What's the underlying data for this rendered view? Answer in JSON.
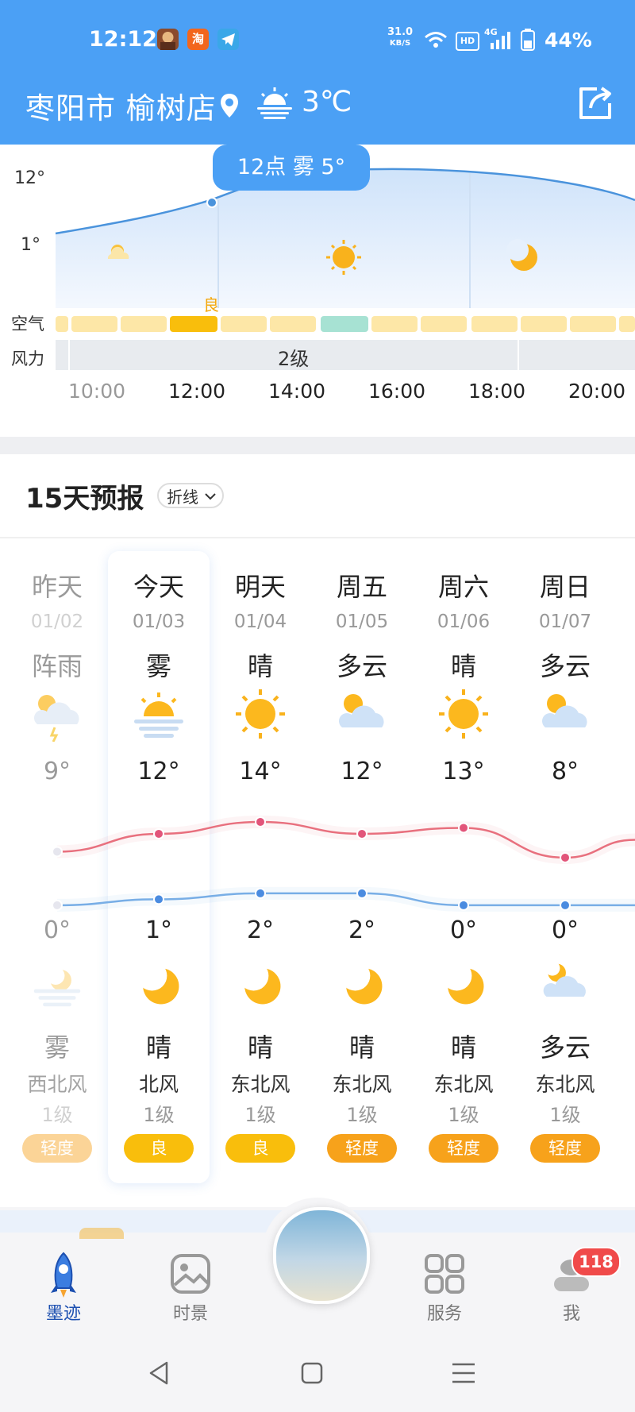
{
  "status_bar": {
    "time": "12:12",
    "app_icons": [
      "game-icon",
      "taobao-icon",
      "telegram-icon"
    ],
    "taobao_label": "淘",
    "net_speed_value": "31.0",
    "net_speed_unit": "KB/S",
    "hd_label": "HD",
    "network_label": "4G",
    "battery": "44%"
  },
  "header": {
    "location": "枣阳市 榆树店",
    "current_temp": "3℃",
    "weather_icon": "fog-sun-icon"
  },
  "hourly": {
    "tooltip": "12点 雾 5°",
    "y_labels": [
      "12°",
      "1°"
    ],
    "air_label": "空气",
    "air_quality_marker": "良",
    "wind_label": "风力",
    "wind_value": "2级",
    "times": [
      "10:00",
      "12:00",
      "14:00",
      "16:00",
      "18:00",
      "20:00"
    ],
    "icons": [
      "sun-cloud-icon",
      "sun-icon",
      "moon-icon"
    ],
    "chart_data": {
      "type": "area",
      "x": [
        "10:00",
        "11:00",
        "12:00",
        "13:00",
        "14:00",
        "16:00",
        "18:00",
        "20:00"
      ],
      "series": [
        {
          "values": [
            3,
            4,
            5,
            8,
            10,
            11,
            10,
            9
          ]
        }
      ],
      "ylim": [
        0,
        12
      ]
    }
  },
  "forecast": {
    "title": "15天预报",
    "mode_toggle": "折线",
    "days": [
      {
        "day": "昨天",
        "date": "01/02",
        "day_weather": "阵雨",
        "day_icon": "shower-icon",
        "high": "9°",
        "low": "0°",
        "night_icon": "fog-moon-icon",
        "night_weather": "雾",
        "wind_dir": "西北风",
        "wind_level": "1级",
        "aqi": "轻度",
        "aqi_color": "#f7a21b"
      },
      {
        "day": "今天",
        "date": "01/03",
        "day_weather": "雾",
        "day_icon": "fog-sun-icon",
        "high": "12°",
        "low": "1°",
        "night_icon": "moon-icon",
        "night_weather": "晴",
        "wind_dir": "北风",
        "wind_level": "1级",
        "aqi": "良",
        "aqi_color": "#f9be0c"
      },
      {
        "day": "明天",
        "date": "01/04",
        "day_weather": "晴",
        "day_icon": "sun-icon",
        "high": "14°",
        "low": "2°",
        "night_icon": "moon-icon",
        "night_weather": "晴",
        "wind_dir": "东北风",
        "wind_level": "1级",
        "aqi": "良",
        "aqi_color": "#f9be0c"
      },
      {
        "day": "周五",
        "date": "01/05",
        "day_weather": "多云",
        "day_icon": "sun-cloud-icon",
        "high": "12°",
        "low": "2°",
        "night_icon": "moon-icon",
        "night_weather": "晴",
        "wind_dir": "东北风",
        "wind_level": "1级",
        "aqi": "轻度",
        "aqi_color": "#f7a21b"
      },
      {
        "day": "周六",
        "date": "01/06",
        "day_weather": "晴",
        "day_icon": "sun-icon",
        "high": "13°",
        "low": "0°",
        "night_icon": "moon-icon",
        "night_weather": "晴",
        "wind_dir": "东北风",
        "wind_level": "1级",
        "aqi": "轻度",
        "aqi_color": "#f7a21b"
      },
      {
        "day": "周日",
        "date": "01/07",
        "day_weather": "多云",
        "day_icon": "sun-cloud-icon",
        "high": "8°",
        "low": "0°",
        "night_icon": "moon-cloud-icon",
        "night_weather": "多云",
        "wind_dir": "东北风",
        "wind_level": "1级",
        "aqi": "轻度",
        "aqi_color": "#f7a21b"
      }
    ],
    "chart_data": {
      "type": "line",
      "categories": [
        "01/02",
        "01/03",
        "01/04",
        "01/05",
        "01/06",
        "01/07"
      ],
      "series": [
        {
          "values": [
            9,
            12,
            14,
            12,
            13,
            8
          ]
        },
        {
          "values": [
            0,
            1,
            2,
            2,
            0,
            0
          ]
        }
      ],
      "colors": [
        "#e8707e",
        "#78aee6"
      ]
    }
  },
  "bottom_nav": {
    "items": [
      {
        "label": "墨迹",
        "icon": "rocket-icon",
        "active": true
      },
      {
        "label": "时景",
        "icon": "picture-icon",
        "active": false
      },
      {
        "label": "服务",
        "icon": "grid-icon",
        "active": false
      },
      {
        "label": "我",
        "icon": "profile-icon",
        "active": false
      }
    ],
    "badge": "118",
    "center_icon": "sky-photo-icon"
  },
  "colors": {
    "header_blue": "#4ba0f5",
    "high_line": "#e8707e",
    "low_line": "#78aee6"
  }
}
